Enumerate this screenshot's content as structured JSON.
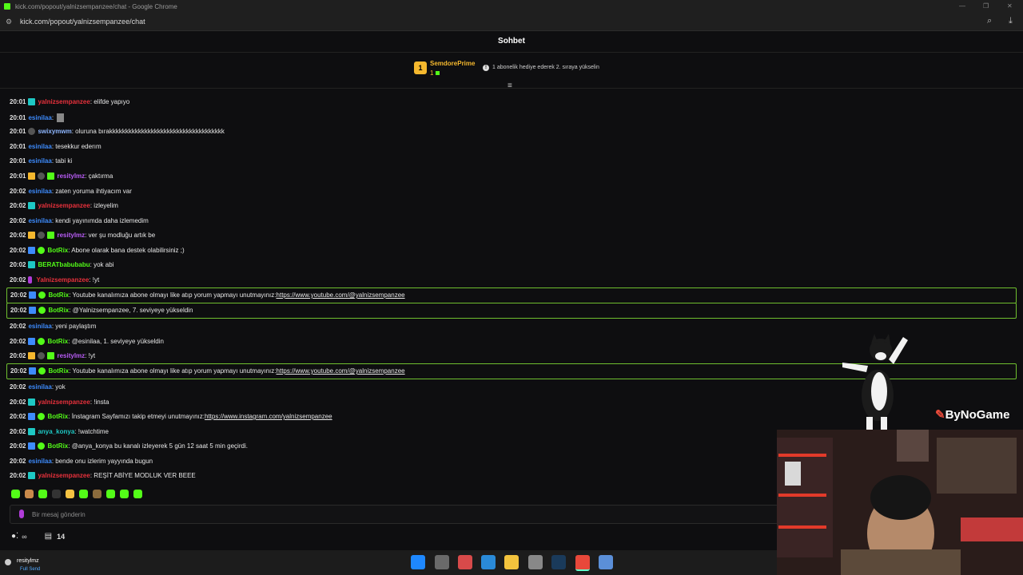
{
  "browser": {
    "window_title": "kick.com/popout/yalnizsempanzee/chat - Google Chrome",
    "url": "kick.com/popout/yalnizsempanzee/chat"
  },
  "chat": {
    "header_title": "Sohbet",
    "pinned": {
      "rank": "1",
      "gifter": "SemdorePrime",
      "gift_count": "1",
      "hint": "1 abonelik hediye ederek 2. sıraya yükselin"
    },
    "messages": [
      {
        "time": "20:01",
        "badges": [
          "sub"
        ],
        "user": "yalnizsempanzee",
        "user_color": "#e8313c",
        "text": ": elifde yapıyo"
      },
      {
        "time": "20:01",
        "badges": [],
        "user": "esinilaa",
        "user_color": "#3d8bfd",
        "text": ":",
        "emote": true
      },
      {
        "time": "20:01",
        "badges": [
          "og"
        ],
        "user": "swixymwm",
        "user_color": "#8fb7ff",
        "text": ": oluruna bırakkkkkkkkkkkkkkkkkkkkkkkkkkkkkkkkkkkk"
      },
      {
        "time": "20:01",
        "badges": [],
        "user": "esinilaa",
        "user_color": "#3d8bfd",
        "text": ": tesekkur ederım"
      },
      {
        "time": "20:01",
        "badges": [],
        "user": "esinilaa",
        "user_color": "#3d8bfd",
        "text": ": tabi ki"
      },
      {
        "time": "20:01",
        "badges": [
          "crown",
          "og",
          "gift"
        ],
        "user": "resitylmz",
        "user_color": "#b85cf5",
        "text": ": çaktırma"
      },
      {
        "time": "20:02",
        "badges": [],
        "user": "esinilaa",
        "user_color": "#3d8bfd",
        "text": ": zaten yoruma ihtiyacım var"
      },
      {
        "time": "20:02",
        "badges": [
          "sub"
        ],
        "user": "yalnizsempanzee",
        "user_color": "#e8313c",
        "text": ": izleyelim"
      },
      {
        "time": "20:02",
        "badges": [],
        "user": "esinilaa",
        "user_color": "#3d8bfd",
        "text": ": kendi yayınımda daha izlemedim"
      },
      {
        "time": "20:02",
        "badges": [
          "crown",
          "og",
          "gift"
        ],
        "user": "resitylmz",
        "user_color": "#b85cf5",
        "text": ": ver şu modluğu artık be"
      },
      {
        "time": "20:02",
        "badges": [
          "bot",
          "ver"
        ],
        "user": "BotRix",
        "user_color": "#53fc18",
        "text": ": Abone olarak bana destek olabilirsiniz ;)"
      },
      {
        "time": "20:02",
        "badges": [
          "sub"
        ],
        "user": "BERATbabubabu",
        "user_color": "#53fc18",
        "text": ": yok abi"
      },
      {
        "time": "20:02",
        "badges": [
          "mic"
        ],
        "user": "Yalnizsempanzee",
        "user_color": "#e8313c",
        "text": ": !yt"
      },
      {
        "time": "20:02",
        "badges": [
          "bot",
          "ver"
        ],
        "user": "BotRix",
        "user_color": "#53fc18",
        "text": ": Youtube kanalımıza abone olmayı like atıp yorum yapmayı unutmayınız: ",
        "link": "https://www.youtube.com/@yalnizsempanzee",
        "highlight": true
      },
      {
        "time": "20:02",
        "badges": [
          "bot",
          "ver"
        ],
        "user": "BotRix",
        "user_color": "#53fc18",
        "text": ": @Yalnizsempanzee, 7. seviyeye yükseldin",
        "highlight": true
      },
      {
        "time": "20:02",
        "badges": [],
        "user": "esinilaa",
        "user_color": "#3d8bfd",
        "text": ": yeni paylaştım"
      },
      {
        "time": "20:02",
        "badges": [
          "bot",
          "ver"
        ],
        "user": "BotRix",
        "user_color": "#53fc18",
        "text": ": @esinilaa, 1. seviyeye yükseldin"
      },
      {
        "time": "20:02",
        "badges": [
          "crown",
          "og",
          "gift"
        ],
        "user": "resitylmz",
        "user_color": "#b85cf5",
        "text": ": !yt"
      },
      {
        "time": "20:02",
        "badges": [
          "bot",
          "ver"
        ],
        "user": "BotRix",
        "user_color": "#53fc18",
        "text": ": Youtube kanalımıza abone olmayı like atıp yorum yapmayı unutmayınız: ",
        "link": "https://www.youtube.com/@yalnizsempanzee",
        "highlight": true
      },
      {
        "time": "20:02",
        "badges": [],
        "user": "esinilaa",
        "user_color": "#3d8bfd",
        "text": ": yok"
      },
      {
        "time": "20:02",
        "badges": [
          "sub"
        ],
        "user": "yalnizsempanzee",
        "user_color": "#e8313c",
        "text": ": !insta"
      },
      {
        "time": "20:02",
        "badges": [
          "bot",
          "ver"
        ],
        "user": "BotRix",
        "user_color": "#53fc18",
        "text": ": İnstagram Sayfamızı takip etmeyi unutmayınız: ",
        "link": "https://www.instagram.com/yalnizsempanzee"
      },
      {
        "time": "20:02",
        "badges": [
          "sub"
        ],
        "user": "anya_konya",
        "user_color": "#1ec8c4",
        "text": ": !watchtime"
      },
      {
        "time": "20:02",
        "badges": [
          "bot",
          "ver"
        ],
        "user": "BotRix",
        "user_color": "#53fc18",
        "text": ": @anya_konya bu kanalı izleyerek 5 gün 12 saat 5 min geçirdi."
      },
      {
        "time": "20:02",
        "badges": [],
        "user": "esinilaa",
        "user_color": "#3d8bfd",
        "text": ": bende onu izlerim yayyında bugun"
      },
      {
        "time": "20:02",
        "badges": [
          "sub"
        ],
        "user": "yalnizsempanzee",
        "user_color": "#e8313c",
        "text": ": REŞİT ABİYE MODLUK VER BEEE"
      }
    ],
    "emote_bar": [
      "#53fc18",
      "#c98a4b",
      "#53fc18",
      "#333",
      "#f5c242",
      "#53fc18",
      "#8b6b3d",
      "#53fc18",
      "#53fc18",
      "#53fc18"
    ],
    "input_placeholder": "Bir mesaj gönderin",
    "viewers_symbol": "∞",
    "gift_total": "14"
  },
  "overlay": {
    "brand": "ByNoGame"
  },
  "taskbar": {
    "user_name": "resitylmz",
    "user_status": "Full Send",
    "apps": [
      "windows",
      "taskview",
      "snip",
      "photos",
      "explorer",
      "vpn",
      "steam",
      "chrome",
      "notepad"
    ]
  }
}
